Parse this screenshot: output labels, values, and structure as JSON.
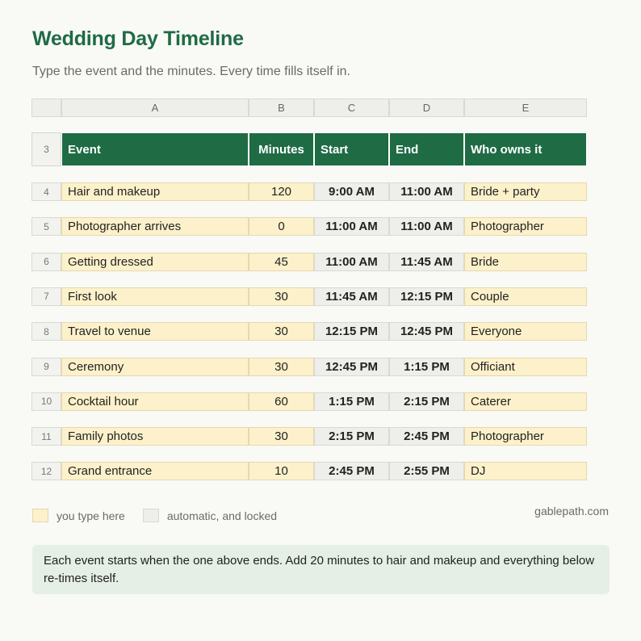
{
  "title": "Wedding Day Timeline",
  "subtitle": "Type the event and the minutes. Every time fills itself in.",
  "colors": {
    "accent": "#1f6b44",
    "input_fill": "#fcf1ca",
    "auto_fill": "#eeeeeb",
    "note_fill": "#e5efe6"
  },
  "sheet": {
    "column_letters": [
      "A",
      "B",
      "C",
      "D",
      "E"
    ],
    "header_row_number": "3",
    "headers": [
      "Event",
      "Minutes",
      "Start",
      "End",
      "Who owns it"
    ],
    "rows": [
      {
        "num": "4",
        "event": "Hair and makeup",
        "minutes": "120",
        "start": "9:00 AM",
        "end": "11:00 AM",
        "owner": "Bride + party"
      },
      {
        "num": "5",
        "event": "Photographer arrives",
        "minutes": "0",
        "start": "11:00 AM",
        "end": "11:00 AM",
        "owner": "Photographer"
      },
      {
        "num": "6",
        "event": "Getting dressed",
        "minutes": "45",
        "start": "11:00 AM",
        "end": "11:45 AM",
        "owner": "Bride"
      },
      {
        "num": "7",
        "event": "First look",
        "minutes": "30",
        "start": "11:45 AM",
        "end": "12:15 PM",
        "owner": "Couple"
      },
      {
        "num": "8",
        "event": "Travel to venue",
        "minutes": "30",
        "start": "12:15 PM",
        "end": "12:45 PM",
        "owner": "Everyone"
      },
      {
        "num": "9",
        "event": "Ceremony",
        "minutes": "30",
        "start": "12:45 PM",
        "end": "1:15 PM",
        "owner": "Officiant"
      },
      {
        "num": "10",
        "event": "Cocktail hour",
        "minutes": "60",
        "start": "1:15 PM",
        "end": "2:15 PM",
        "owner": "Caterer"
      },
      {
        "num": "11",
        "event": "Family photos",
        "minutes": "30",
        "start": "2:15 PM",
        "end": "2:45 PM",
        "owner": "Photographer"
      },
      {
        "num": "12",
        "event": "Grand entrance",
        "minutes": "10",
        "start": "2:45 PM",
        "end": "2:55 PM",
        "owner": "DJ"
      }
    ]
  },
  "legend": {
    "input_label": "you type here",
    "auto_label": "automatic, and locked"
  },
  "brand": "gablepath.com",
  "note": "Each event starts when the one above ends. Add 20 minutes to hair and makeup and everything below re-times itself."
}
